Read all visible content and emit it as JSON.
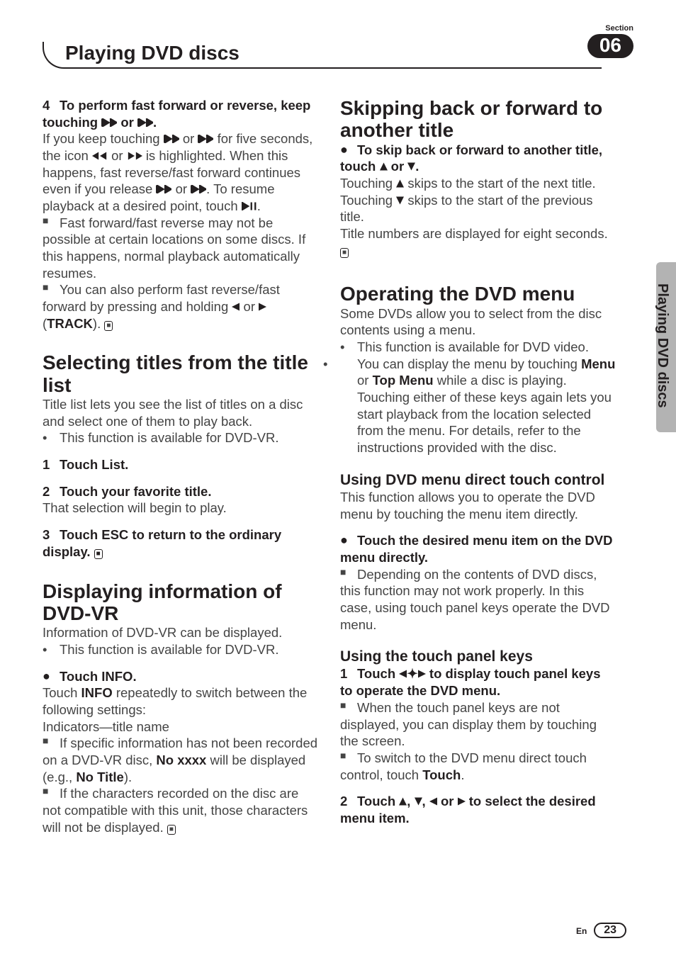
{
  "header": {
    "section_label": "Section",
    "section_number": "06",
    "title": "Playing DVD discs"
  },
  "side_tab": "Playing DVD discs",
  "footer": {
    "lang": "En",
    "page": "23"
  },
  "left": {
    "step4": {
      "num": "4",
      "title": "To perform fast forward or reverse, keep touching ",
      "title_tail": "."
    },
    "p4a_a": "If you keep touching ",
    "p4a_b": " for five seconds, the icon ",
    "p4a_c": " is highlighted. When this happens, fast reverse/fast forward continues even if you release ",
    "p4a_d": ". To resume playback at a desired point, touch ",
    "p4a_e": ".",
    "p4b": "Fast forward/fast reverse may not be possible at certain locations on some discs. If this happens, normal playback automatically resumes.",
    "p4c_a": "You can also perform fast reverse/fast forward by pressing and holding ",
    "p4c_b": " (",
    "p4c_c": "TRACK",
    "p4c_d": ").",
    "h_sel": "Selecting titles from the title list",
    "sel_p1": "Title list lets you see the list of titles on a disc and select one of them to play back.",
    "sel_b1": "This function is available for DVD-VR.",
    "sel_s1": {
      "num": "1",
      "text": "Touch List."
    },
    "sel_s2": {
      "num": "2",
      "text": "Touch your favorite title."
    },
    "sel_s2p": "That selection will begin to play.",
    "sel_s3": {
      "num": "3",
      "text": "Touch ESC to return to the ordinary display."
    },
    "h_disp": "Displaying information of DVD-VR",
    "disp_p1": "Information of DVD-VR can be displayed.",
    "disp_b1": "This function is available for DVD-VR.",
    "disp_bp": "Touch INFO.",
    "disp_p2a": "Touch ",
    "disp_p2b": "INFO",
    "disp_p2c": " repeatedly to switch between the following settings:",
    "disp_p3": "Indicators—title name",
    "disp_sq1_a": "If specific information has not been recorded on a DVD-VR disc, ",
    "disp_sq1_b": "No xxxx",
    "disp_sq1_c": " will be displayed (e.g., ",
    "disp_sq1_d": "No Title",
    "disp_sq1_e": ").",
    "disp_sq2": "If the characters recorded on the disc are not compatible with this unit, those characters will not be displayed."
  },
  "right": {
    "h_skip": "Skipping back or forward to another title",
    "skip_bp_a": "To skip back or forward to another title, touch ",
    "skip_bp_b": ".",
    "skip_p1_a": "Touching ",
    "skip_p1_b": " skips to the start of the next title. Touching ",
    "skip_p1_c": " skips to the start of the previous title.",
    "skip_p2": "Title numbers are displayed for eight seconds.",
    "h_op": "Operating the DVD menu",
    "op_p1": "Some DVDs allow you to select from the disc contents using a menu.",
    "op_b1": "This function is available for DVD video.",
    "op_b2_a": "You can display the menu by touching ",
    "op_b2_b": "Menu",
    "op_b2_c": " or ",
    "op_b2_d": "Top Menu",
    "op_b2_e": " while a disc is playing. Touching either of these keys again lets you start playback from the location selected from the menu. For details, refer to the instructions provided with the disc.",
    "h_dt": "Using DVD menu direct touch control",
    "dt_p1": "This function allows you to operate the DVD menu by touching the menu item directly.",
    "dt_bp": "Touch the desired menu item on the DVD menu directly.",
    "dt_sq": "Depending on the contents of DVD discs, this function may not work properly. In this case, using touch panel keys operate the DVD menu.",
    "h_tp": "Using the touch panel keys",
    "tp_s1": {
      "num": "1",
      "text_a": "Touch ",
      "text_b": " to display touch panel keys to operate the DVD menu."
    },
    "tp_sq1": "When the touch panel keys are not displayed, you can display them by touching the screen.",
    "tp_sq2_a": "To switch to the DVD menu direct touch control, touch ",
    "tp_sq2_b": "Touch",
    "tp_sq2_c": ".",
    "tp_s2": {
      "num": "2",
      "text_a": "Touch ",
      "text_b": " to select the desired menu item."
    }
  }
}
